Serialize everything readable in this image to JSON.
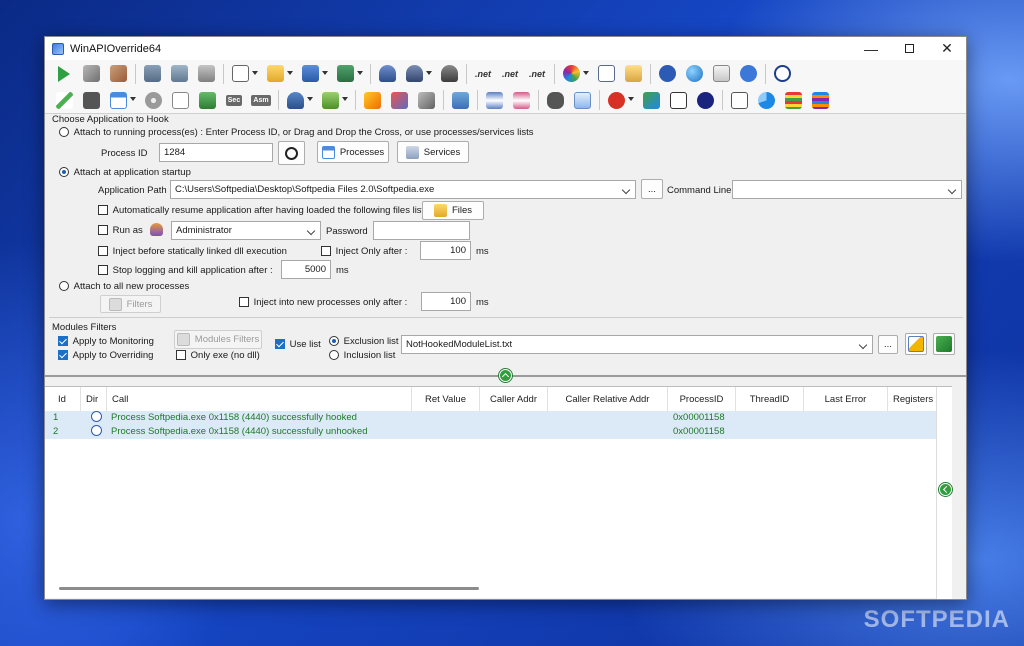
{
  "window": {
    "title": "WinAPIOverride64"
  },
  "colors": {
    "accent": "#1a6fc9",
    "log_text": "#1d7a25",
    "selected_row": "#dce9f7"
  },
  "toolbar1_icons": [
    "start-icon",
    "stop-icon",
    "kill-icon",
    "monitor-icon",
    "monitor2-icon",
    "monitor3-icon",
    "open-icon",
    "folder-icon",
    "save-icon",
    "save-as-icon",
    "user-icon",
    "user-settings-icon",
    "user3-icon",
    "net-icon",
    "net-icon-2",
    "net-icon-3",
    "color-icon",
    "list-icon",
    "edit-icon",
    "help-icon",
    "globe-icon",
    "mail-icon",
    "info-icon",
    "donate-icon"
  ],
  "toolbar2_icons": [
    "pen-icon",
    "chip-icon",
    "window-icon",
    "disk-icon",
    "file-icon",
    "tree-icon",
    "sec-icon",
    "asm-icon",
    "people-icon",
    "plugin-icon",
    "wand-icon",
    "cut-icon",
    "cut2-icon",
    "copy-icon",
    "hourglass-icon",
    "hourglass2-icon",
    "binoculars-icon",
    "doc-icon",
    "close-icon",
    "str-hex-icon",
    "cpp-icon",
    "moon-icon",
    "sum-icon",
    "pie-icon",
    "bars-icon",
    "bars2-icon"
  ],
  "toolbar_text": {
    "net": ".net",
    "sec": "Sec",
    "asm": "Asm"
  },
  "hook": {
    "group_label": "Choose Application to Hook",
    "attach_running": "Attach to running process(es) : Enter Process ID, or Drag and Drop the Cross, or use processes/services lists",
    "process_id_label": "Process ID",
    "process_id": "1284",
    "processes_button": "Processes",
    "services_button": "Services",
    "attach_startup": "Attach at application startup",
    "app_path_label": "Application Path",
    "app_path": "C:\\Users\\Softpedia\\Desktop\\Softpedia Files 2.0\\Softpedia.exe",
    "browse_button": "...",
    "command_line_label": "Command Line",
    "command_line": "",
    "auto_resume": "Automatically resume application after having loaded the following files list",
    "files_button": "Files",
    "run_as": "Run as",
    "run_as_user": "Administrator",
    "password_label": "Password",
    "inject_before": "Inject before statically linked dll execution",
    "inject_only_after": "Inject Only after :",
    "inject_only_after_value": "100",
    "ms": "ms",
    "stop_logging": "Stop logging and kill application after :",
    "stop_logging_value": "5000",
    "attach_all": "Attach to all new processes",
    "filters_button": "Filters",
    "inject_new_only_after": "Inject into new processes only after :",
    "inject_new_only_after_value": "100"
  },
  "modules": {
    "group_label": "Modules Filters",
    "apply_monitoring": "Apply to Monitoring",
    "apply_overriding": "Apply to Overriding",
    "modules_filters_button": "Modules Filters",
    "only_exe": "Only exe (no dll)",
    "use_list": "Use list",
    "exclusion_list": "Exclusion list",
    "inclusion_list": "Inclusion list",
    "list_file": "NotHookedModuleList.txt",
    "browse_button": "..."
  },
  "grid": {
    "columns": [
      "Id",
      "Dir",
      "Call",
      "Ret Value",
      "Caller Addr",
      "Caller Relative Addr",
      "ProcessID",
      "ThreadID",
      "Last Error",
      "Registers Befo"
    ],
    "rows": [
      {
        "id": "1",
        "call": "Process Softpedia.exe 0x1158 (4440) successfully hooked",
        "pid": "0x00001158"
      },
      {
        "id": "2",
        "call": "Process Softpedia.exe 0x1158 (4440) successfully unhooked",
        "pid": "0x00001158"
      }
    ]
  },
  "watermark": "SOFTPEDIA"
}
